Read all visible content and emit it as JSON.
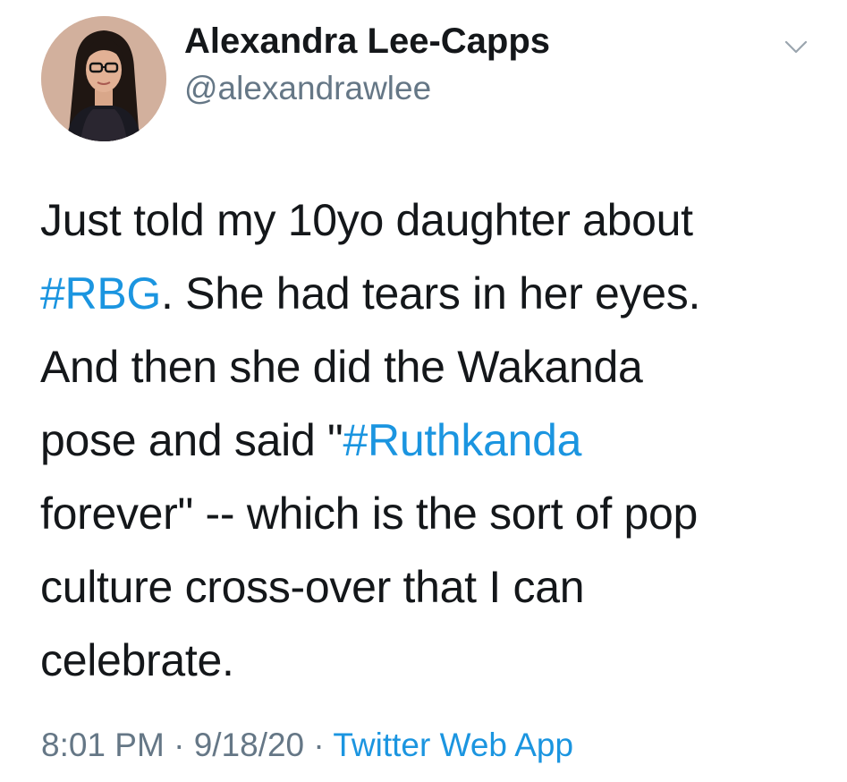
{
  "author": {
    "display_name": "Alexandra Lee-Capps",
    "handle": "@alexandrawlee",
    "avatar_icon": "profile-photo"
  },
  "menu": {
    "icon": "chevron-down-icon"
  },
  "tweet": {
    "lines": [
      [
        {
          "t": "Just told my 10yo daughter about"
        }
      ],
      [
        {
          "t": "#RBG",
          "tag": true
        },
        {
          "t": ". She had tears in her eyes."
        }
      ],
      [
        {
          "t": "And then she did the Wakanda"
        }
      ],
      [
        {
          "t": "pose and said \""
        },
        {
          "t": "#Ruthkanda",
          "tag": true
        }
      ],
      [
        {
          "t": "forever\" -- which is the sort of pop"
        }
      ],
      [
        {
          "t": "culture cross-over that I can"
        }
      ],
      [
        {
          "t": "celebrate."
        }
      ]
    ]
  },
  "meta": {
    "time": "8:01 PM",
    "sep1": " · ",
    "date": "9/18/20",
    "sep2": " · ",
    "source": "Twitter Web App"
  },
  "colors": {
    "hashtag": "#1b95e0",
    "secondary_text": "#657786",
    "primary_text": "#14171a"
  }
}
